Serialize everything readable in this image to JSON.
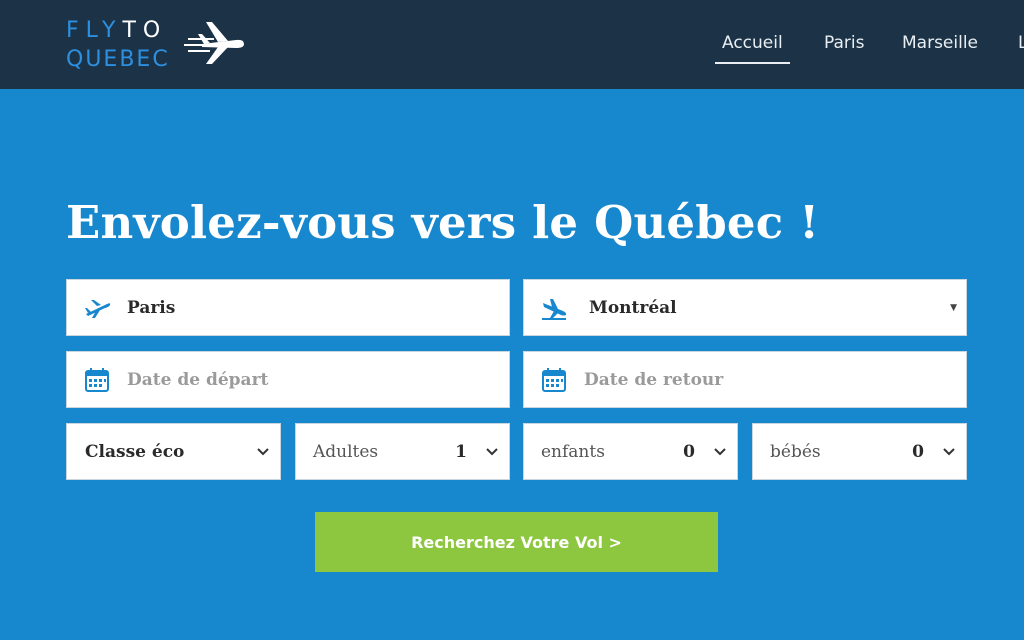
{
  "brand": {
    "line1_a": "FLY",
    "line1_b": "TO",
    "line2": "QUEBEC"
  },
  "nav": {
    "items": [
      "Accueil",
      "Paris",
      "Marseille",
      "L"
    ],
    "active": "Accueil"
  },
  "hero": {
    "title": "Envolez-vous vers le Québec !"
  },
  "search": {
    "from": "Paris",
    "to": "Montréal",
    "departure_placeholder": "Date de départ",
    "return_placeholder": "Date de retour",
    "class": "Classe éco",
    "adults_label": "Adultes",
    "adults_value": "1",
    "children_label": "enfants",
    "children_value": "0",
    "babies_label": "bébés",
    "babies_value": "0",
    "button_label": "Recherchez Votre Vol >"
  },
  "colors": {
    "header": "#1c3347",
    "background": "#1787ce",
    "button": "#8dc63f",
    "logo_blue": "#2d8fe0",
    "icon_blue": "#1787ce"
  },
  "icons": {
    "from": "plane-takeoff-icon",
    "to": "plane-landing-icon",
    "date": "calendar-icon",
    "dropdown": "chevron-down-icon"
  }
}
